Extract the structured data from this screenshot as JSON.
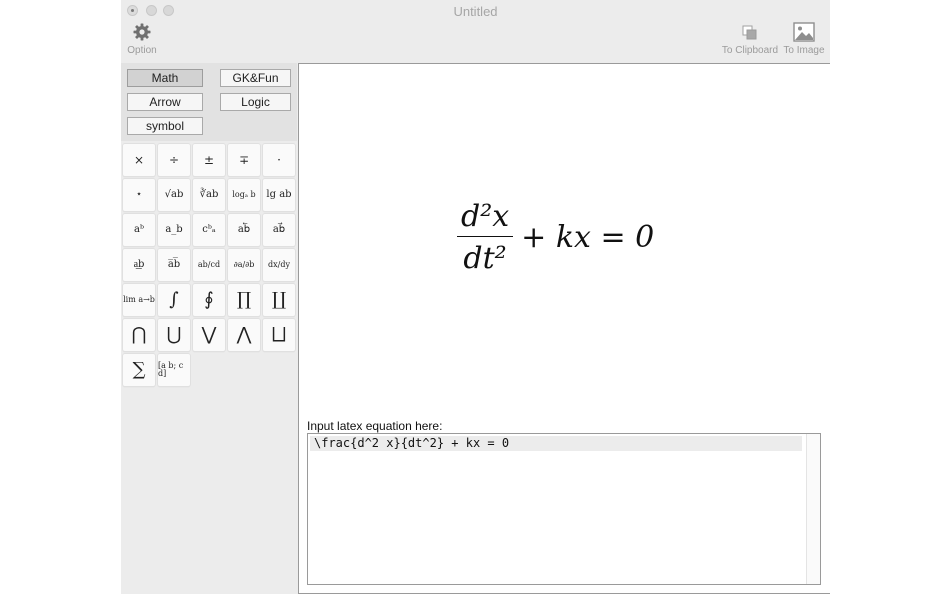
{
  "window": {
    "title": "Untitled"
  },
  "toolbar": {
    "option_label": "Option",
    "clipboard_label": "To Clipboard",
    "image_label": "To Image"
  },
  "categories": [
    {
      "label": "Math",
      "active": true
    },
    {
      "label": "GK&Fun",
      "active": false
    },
    {
      "label": "Arrow",
      "active": false
    },
    {
      "label": "Logic",
      "active": false
    },
    {
      "label": "symbol",
      "active": false
    }
  ],
  "symbols": [
    "×",
    "÷",
    "±",
    "∓",
    "·",
    "⋆",
    "√ab",
    "∛ab",
    "logₐ b",
    "lg ab",
    "aᵇ",
    "a_b",
    "cᵇₐ",
    "ab⃖",
    "ab⃗",
    "a͟b",
    "a̅b̅",
    "ab/cd",
    "∂a/∂b",
    "dx/dy",
    "lim a→b",
    "∫",
    "∮",
    "∏",
    "∐",
    "⋂",
    "⋃",
    "⋁",
    "⋀",
    "⨆",
    "∑",
    "[a b; c d]"
  ],
  "equation": {
    "numerator": "d²x",
    "denominator": "dt²",
    "rest": "+ kx = 0"
  },
  "input": {
    "label": "Input latex equation here:",
    "value": "\\frac{d^2 x}{dt^2} + kx = 0"
  }
}
